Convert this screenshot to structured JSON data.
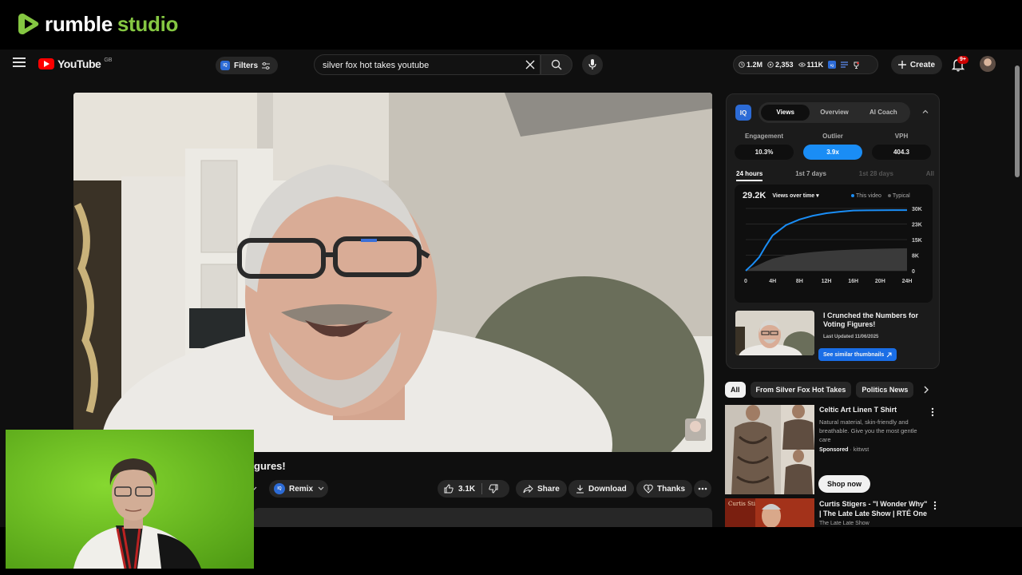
{
  "rumble": {
    "brand": "rumble",
    "product": "studio",
    "accent": "#85c742"
  },
  "header": {
    "logo_text": "YouTube",
    "region": "GB",
    "filters_label": "Filters",
    "search_value": "silver fox hot takes youtube",
    "stats": {
      "views": "1.2M",
      "subscribers": "2,353",
      "watch": "111K"
    },
    "create_label": "Create",
    "notification_badge": "9+"
  },
  "video": {
    "title_partial": "gures!",
    "remix_label": "Remix",
    "like_count": "3.1K",
    "share_label": "Share",
    "download_label": "Download",
    "thanks_label": "Thanks"
  },
  "vidiq": {
    "logo": "IQ",
    "tabs": [
      "Views",
      "Overview",
      "AI Coach"
    ],
    "active_tab": "Views",
    "metrics": [
      {
        "label": "Engagement",
        "value": "10.3%"
      },
      {
        "label": "Outlier",
        "value": "3.9x"
      },
      {
        "label": "VPH",
        "value": "404.3"
      }
    ],
    "ranges": [
      "24 hours",
      "1st 7 days",
      "1st 28 days",
      "All"
    ],
    "chart_total": "29.2K",
    "chart_dropdown": "Views over time",
    "legend": [
      "This video",
      "Typical"
    ],
    "y_ticks": [
      "30K",
      "23K",
      "15K",
      "8K",
      "0"
    ],
    "x_ticks": [
      "0",
      "4H",
      "8H",
      "12H",
      "16H",
      "20H",
      "24H"
    ],
    "thumb_title": "I Crunched the Numbers for Voting Figures!",
    "last_updated": "Last Updated 11/06/2025",
    "similar_label": "See similar thumbnails",
    "accent": "#1a8df5"
  },
  "chart_data": {
    "type": "area",
    "title": "",
    "x": [
      0,
      1,
      2,
      3,
      4,
      6,
      8,
      10,
      12,
      14,
      16,
      18,
      20,
      22,
      24
    ],
    "series": [
      {
        "name": "This video",
        "values": [
          0,
          3000,
          6500,
          12000,
          17000,
          22000,
          24700,
          26500,
          27700,
          28400,
          29000,
          29100,
          29150,
          29180,
          29200
        ]
      },
      {
        "name": "Typical",
        "values": [
          0,
          1500,
          3000,
          4500,
          5800,
          7300,
          8300,
          9000,
          9500,
          9900,
          10200,
          10400,
          10600,
          10700,
          10800
        ]
      }
    ],
    "xlabel": "",
    "ylabel": "",
    "xlim": [
      0,
      24
    ],
    "ylim": [
      0,
      30000
    ],
    "x_tick_labels": [
      "0",
      "4H",
      "8H",
      "12H",
      "16H",
      "20H",
      "24H"
    ],
    "y_tick_labels": [
      "0",
      "8K",
      "15K",
      "23K",
      "30K"
    ]
  },
  "chips": [
    "All",
    "From Silver Fox Hot Takes",
    "Politics News"
  ],
  "sidebar": {
    "ad": {
      "title": "Celtic Art Linen T Shirt",
      "description": "Natural material, skin-friendly and breathable. Give you the most gentle care",
      "sponsored": "Sponsored",
      "advertiser": "kittwst",
      "cta": "Shop now"
    },
    "rec": {
      "title": "Curtis Stigers - \"I Wonder Why\" | The Late Late Show | RTÉ One",
      "channel": "The Late Late Show",
      "thumb_text": "Curtis Stigers"
    }
  }
}
